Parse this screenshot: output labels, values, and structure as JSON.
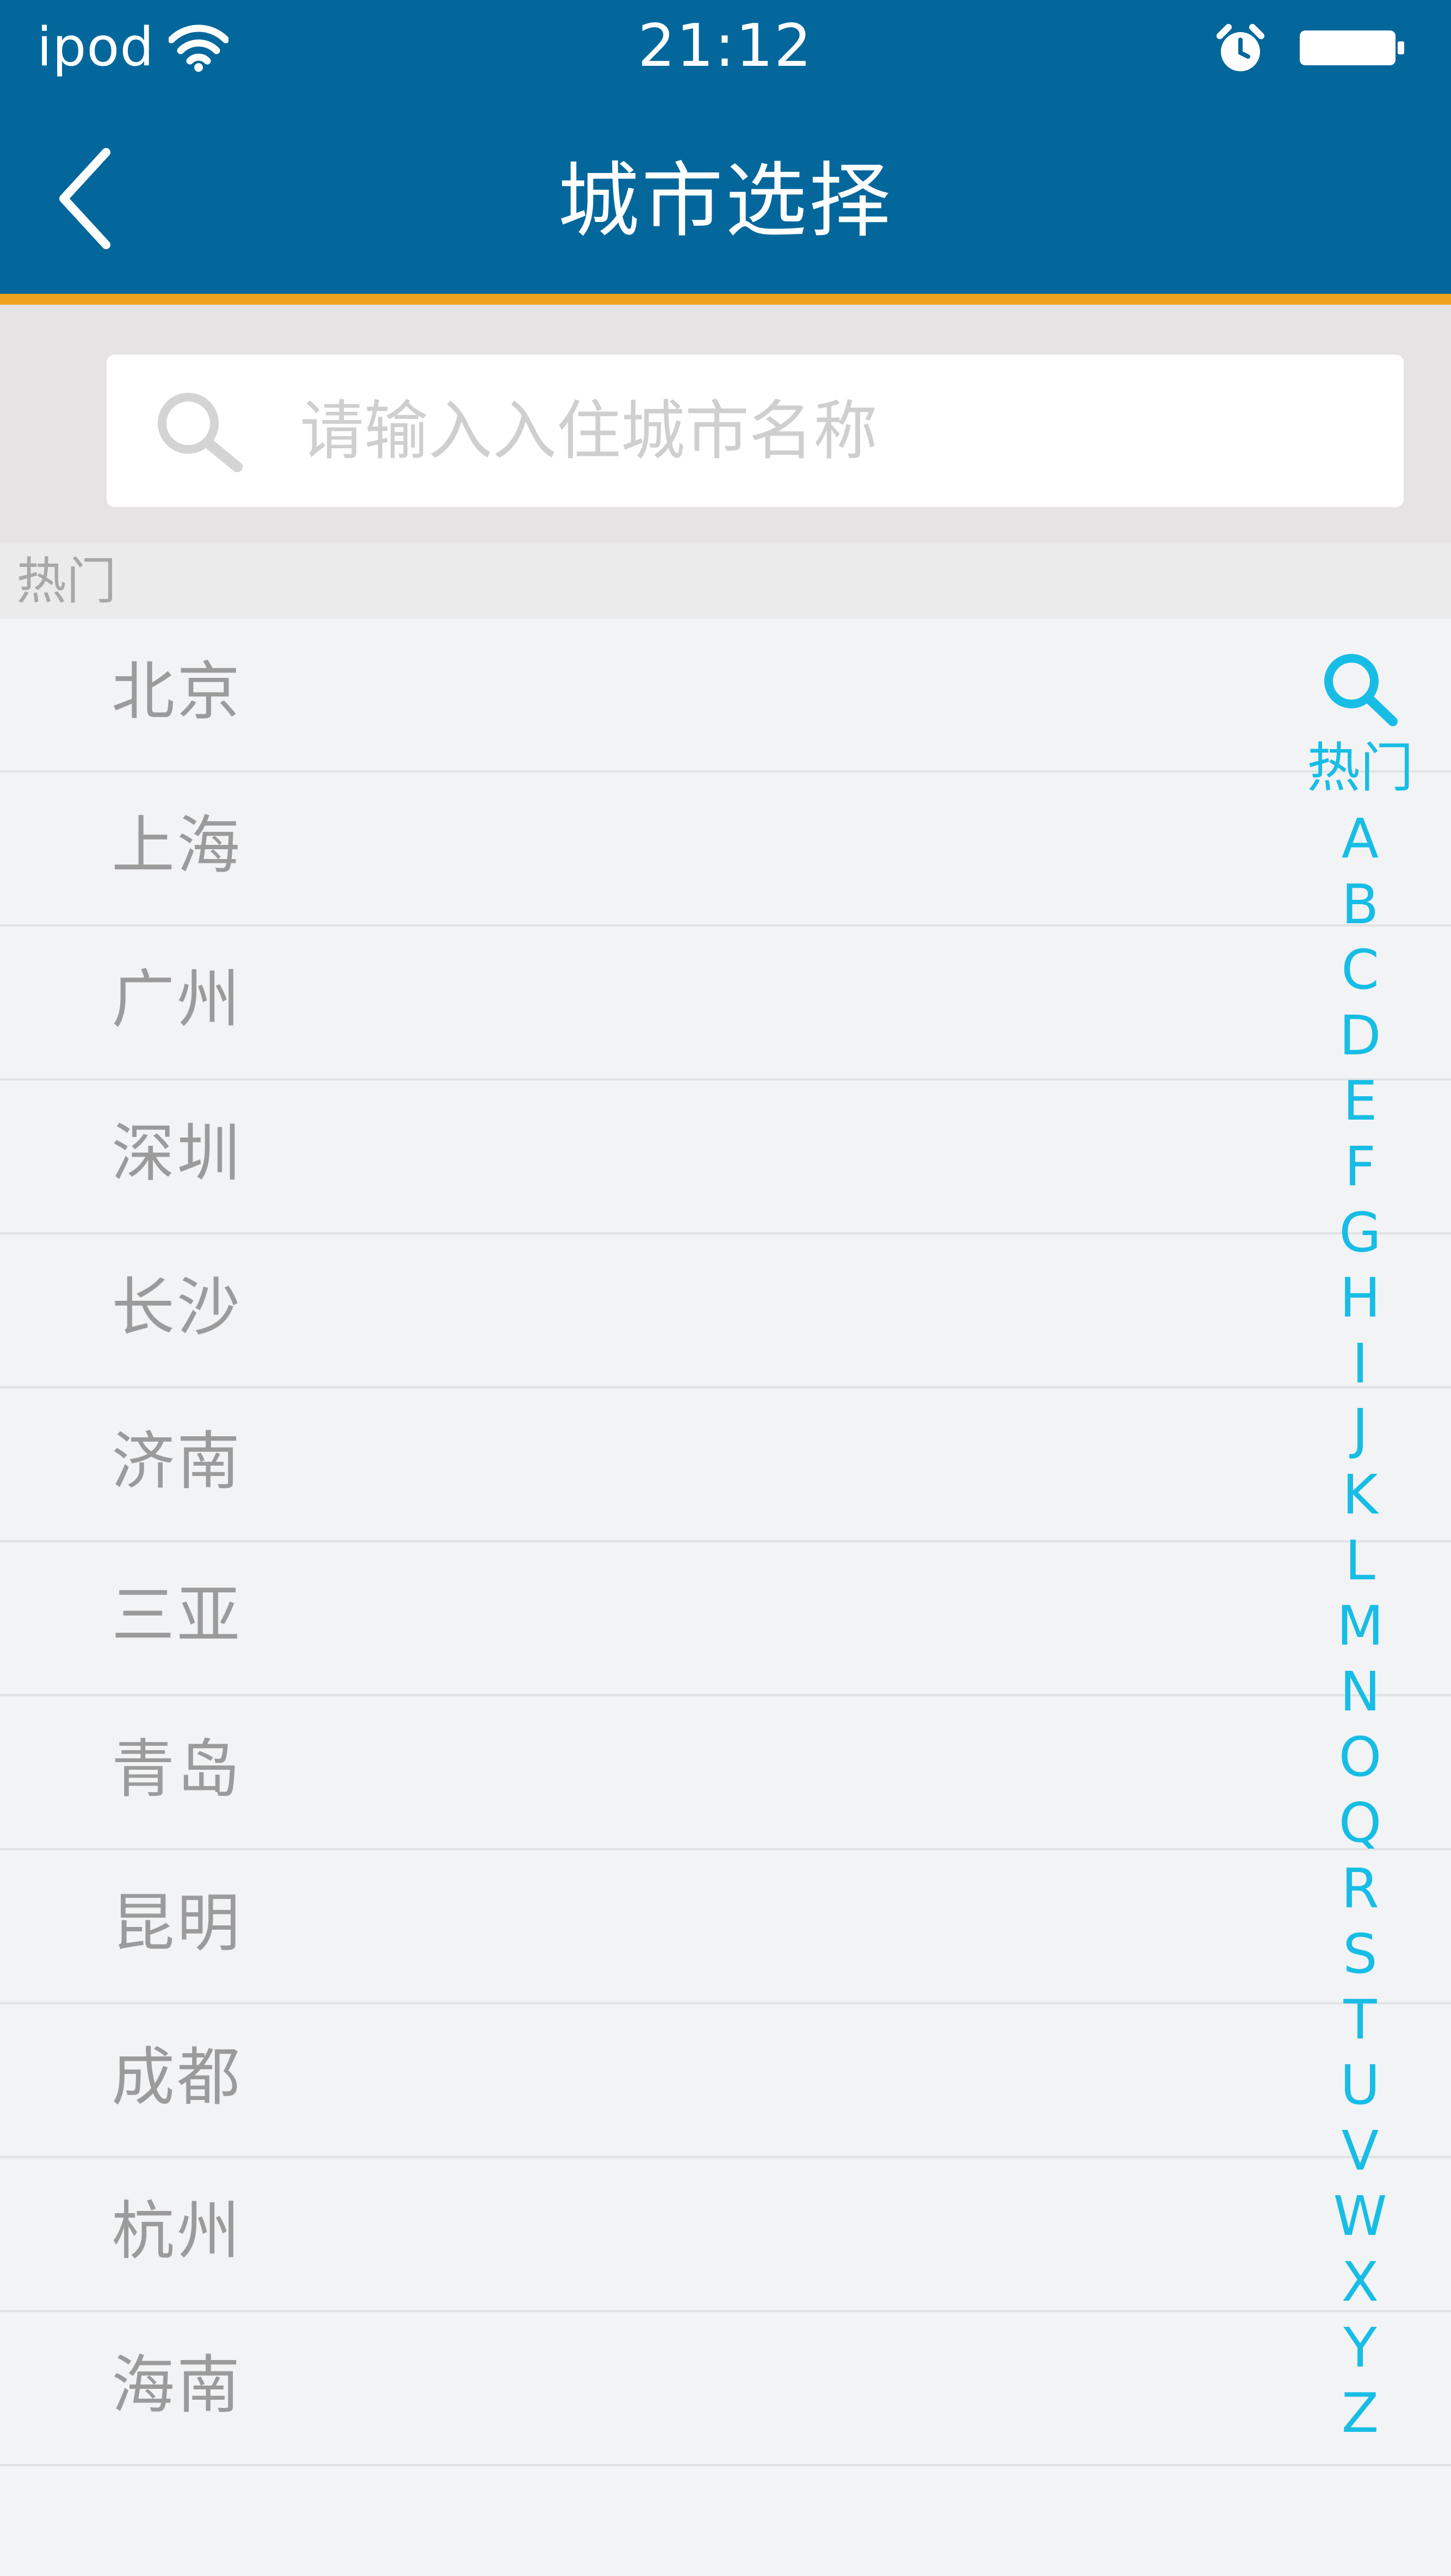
{
  "colors": {
    "header_bg": "#03679c",
    "accent": "#eea21e",
    "index_text": "#17bde5",
    "city_text": "#9b9b9b",
    "list_bg": "#f2f3f5"
  },
  "status_bar": {
    "carrier": "ipod",
    "time": "21:12",
    "icons": [
      "wifi-icon",
      "alarm-icon",
      "battery-icon"
    ]
  },
  "nav": {
    "title": "城市选择",
    "back_icon": "back-chevron-icon"
  },
  "search": {
    "placeholder": "请输入入住城市名称",
    "value": "",
    "icon": "search-icon"
  },
  "section": {
    "title": "热门"
  },
  "cities": [
    {
      "name": "北京"
    },
    {
      "name": "上海"
    },
    {
      "name": "广州"
    },
    {
      "name": "深圳"
    },
    {
      "name": "长沙"
    },
    {
      "name": "济南"
    },
    {
      "name": "三亚"
    },
    {
      "name": "青岛"
    },
    {
      "name": "昆明"
    },
    {
      "name": "成都"
    },
    {
      "name": "杭州"
    },
    {
      "name": "海南"
    }
  ],
  "index": {
    "search_icon": "search-icon",
    "hot_label": "热门",
    "letters": [
      "A",
      "B",
      "C",
      "D",
      "E",
      "F",
      "G",
      "H",
      "I",
      "J",
      "K",
      "L",
      "M",
      "N",
      "O",
      "Q",
      "R",
      "S",
      "T",
      "U",
      "V",
      "W",
      "X",
      "Y",
      "Z"
    ]
  }
}
